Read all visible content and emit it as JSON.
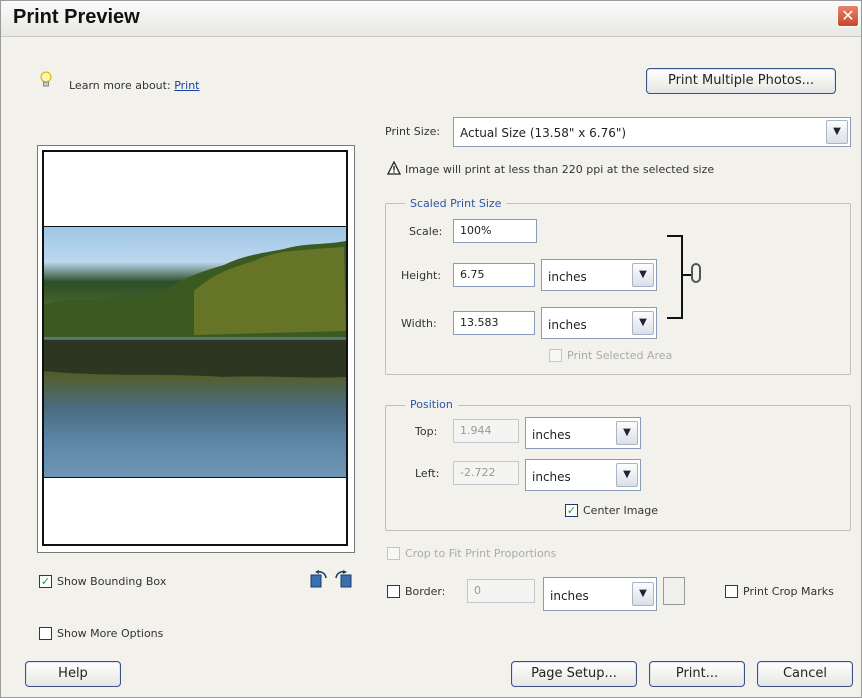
{
  "window": {
    "title": "Print Preview",
    "close_glyph": "✕"
  },
  "learn_more": {
    "prefix": "Learn more about:",
    "link": "Print"
  },
  "print_multiple_label": "Print Multiple Photos...",
  "print_size": {
    "label": "Print Size:",
    "value": "Actual Size (13.58\" x 6.76\")"
  },
  "warning": "Image will print at less than 220 ppi at the selected size",
  "scaled": {
    "title": "Scaled Print Size",
    "scale_label": "Scale:",
    "scale_value": "100%",
    "height_label": "Height:",
    "height_value": "6.75",
    "height_unit": "inches",
    "width_label": "Width:",
    "width_value": "13.583",
    "width_unit": "inches",
    "print_selected_area": "Print Selected Area"
  },
  "position": {
    "title": "Position",
    "top_label": "Top:",
    "top_value": "1.944",
    "top_unit": "inches",
    "left_label": "Left:",
    "left_value": "-2.722",
    "left_unit": "inches",
    "center_image": "Center Image"
  },
  "crop_to_fit": "Crop to Fit Print Proportions",
  "border": {
    "label": "Border:",
    "value": "0",
    "unit": "inches"
  },
  "print_crop_marks": "Print Crop Marks",
  "show_bounding_box": "Show Bounding Box",
  "show_more_options": "Show More Options",
  "buttons": {
    "help": "Help",
    "page_setup": "Page Setup...",
    "print": "Print...",
    "cancel": "Cancel"
  },
  "glyphs": {
    "check": "✓",
    "arrow": "▼",
    "warning": "⚠",
    "bulb": "💡"
  },
  "icons": [
    "lightbulb-icon",
    "warning-icon",
    "rotate-left-icon",
    "rotate-right-icon",
    "chain-link-icon"
  ]
}
